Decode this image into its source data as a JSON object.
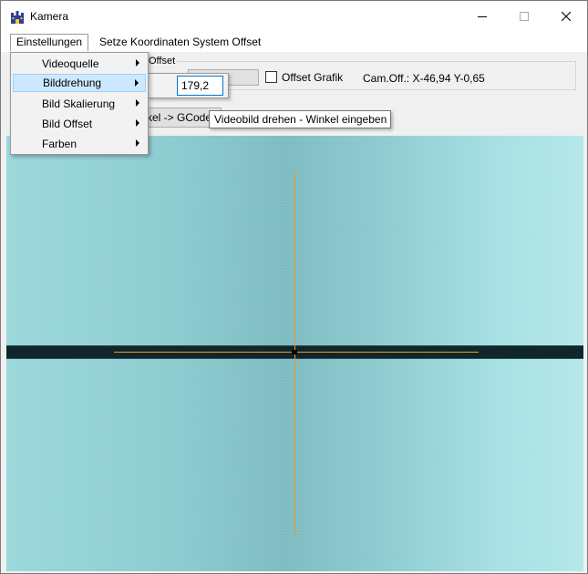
{
  "window": {
    "title": "Kamera",
    "icon": "app-castle-icon"
  },
  "menubar": {
    "items": [
      {
        "label": "Einstellungen"
      },
      {
        "label": "Setze Koordinaten System Offset"
      }
    ]
  },
  "dropdown": {
    "items": [
      {
        "label": "Videoquelle"
      },
      {
        "label": "Bilddrehung"
      },
      {
        "label": "Bild Skalierung"
      },
      {
        "label": "Bild Offset"
      },
      {
        "label": "Farben"
      }
    ],
    "highlighted": "Bilddrehung"
  },
  "submenu": {
    "angle_value": "179,2"
  },
  "toolbar": {
    "group_title": "Offset",
    "offset_graphic_label": "Offset Grafik",
    "offset_graphic_checked": false,
    "cam_offset": "Cam.Off.: X-46,94 Y-0,65",
    "gcode_button_label": "kel -> GCode"
  },
  "tooltip": {
    "text": "Videobild drehen - Winkel eingeben"
  },
  "colors": {
    "crosshair": "#e89a2c",
    "highlight": "#cce8ff"
  }
}
